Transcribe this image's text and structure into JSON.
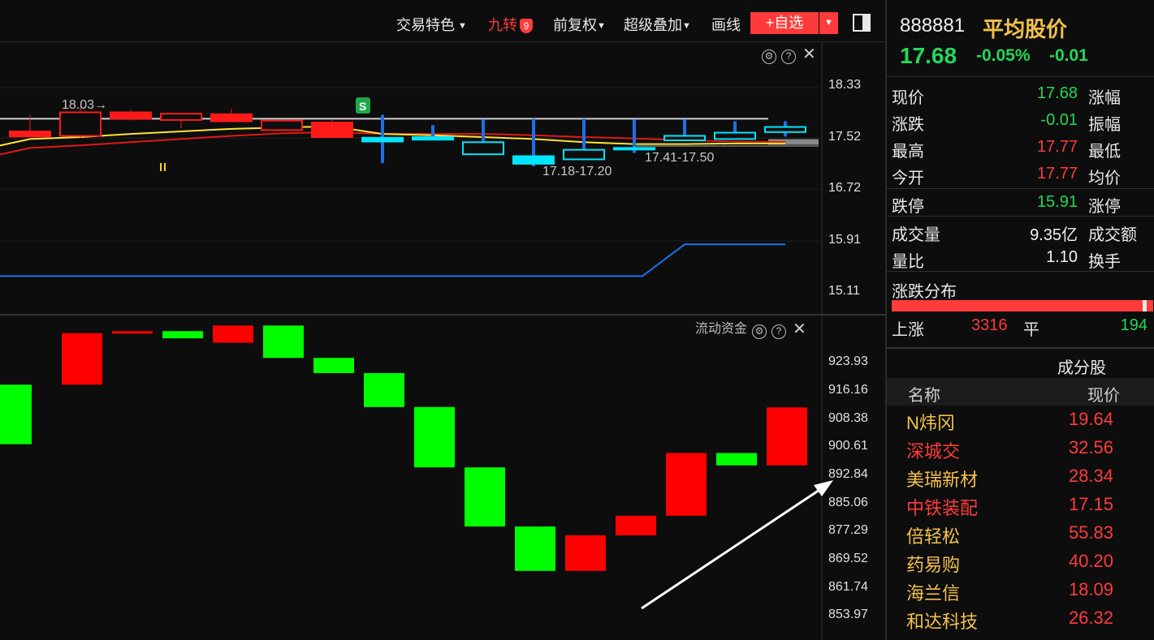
{
  "toolbar": {
    "trade_features": "交易特色",
    "jiuzhuan": "九转",
    "jiuzhuan_badge": "9",
    "fuquan": "前复权",
    "overlay": "超级叠加",
    "draw": "画线",
    "add_watch": "+自选"
  },
  "main_chart": {
    "axis_labels": [
      "18.33",
      "17.52",
      "16.72",
      "15.91",
      "15.11"
    ],
    "annotations": {
      "high_marker": "18.03→",
      "range_1": "17.18-17.20",
      "range_2": "17.41-17.50",
      "signal_badge": "S"
    }
  },
  "sub_chart": {
    "title": "流动资金",
    "axis_labels": [
      "923.93",
      "916.16",
      "908.38",
      "900.61",
      "892.84",
      "885.06",
      "877.29",
      "869.52",
      "861.74",
      "853.97"
    ]
  },
  "chart_data": [
    {
      "type": "candlestick",
      "note_colors": {
        "up": "#ff1a1a",
        "down": "#00e5ff",
        "ma_yellow": "#ffe234",
        "ma_red": "#e01818",
        "blue_line": "#1e6fe6"
      },
      "ylim": [
        15.11,
        18.33
      ],
      "candles": [
        {
          "open": 17.56,
          "close": 17.64,
          "high": 17.9,
          "low": 17.56,
          "dir": "up"
        },
        {
          "open": 17.57,
          "close": 17.94,
          "high": 18.03,
          "low": 17.54,
          "dir": "up"
        },
        {
          "open": 17.84,
          "close": 17.94,
          "high": 17.98,
          "low": 17.81,
          "dir": "up"
        },
        {
          "open": 17.82,
          "close": 17.92,
          "high": 17.92,
          "low": 17.69,
          "dir": "up"
        },
        {
          "open": 17.8,
          "close": 17.91,
          "high": 18.0,
          "low": 17.8,
          "dir": "up"
        },
        {
          "open": 17.66,
          "close": 17.81,
          "high": 17.81,
          "low": 17.66,
          "dir": "up"
        },
        {
          "open": 17.55,
          "close": 17.78,
          "high": 17.82,
          "low": 17.55,
          "dir": "up"
        },
        {
          "open": 17.54,
          "close": 17.48,
          "high": 17.9,
          "low": 17.14,
          "dir": "down"
        },
        {
          "open": 17.55,
          "close": 17.51,
          "high": 17.74,
          "low": 17.51,
          "dir": "down"
        },
        {
          "open": 17.47,
          "close": 17.28,
          "high": 17.83,
          "low": 17.28,
          "dir": "down"
        },
        {
          "open": 17.25,
          "close": 17.13,
          "high": 17.84,
          "low": 17.09,
          "dir": "down"
        },
        {
          "open": 17.35,
          "close": 17.2,
          "high": 17.84,
          "low": 17.2,
          "dir": "down"
        },
        {
          "open": 17.38,
          "close": 17.36,
          "high": 17.83,
          "low": 17.3,
          "dir": "down"
        },
        {
          "open": 17.57,
          "close": 17.5,
          "high": 17.83,
          "low": 17.5,
          "dir": "down"
        },
        {
          "open": 17.62,
          "close": 17.52,
          "high": 17.8,
          "low": 17.52,
          "dir": "down"
        },
        {
          "open": 17.71,
          "close": 17.63,
          "high": 17.8,
          "low": 17.56,
          "dir": "down"
        }
      ],
      "ma_yellow": [
        17.52,
        17.55,
        17.6,
        17.64,
        17.68,
        17.7,
        17.72,
        17.6,
        17.58,
        17.55,
        17.52,
        17.47,
        17.44,
        17.44,
        17.45,
        17.45
      ],
      "ma_red": [
        17.38,
        17.42,
        17.47,
        17.52,
        17.57,
        17.61,
        17.63,
        17.6,
        17.6,
        17.6,
        17.58,
        17.55,
        17.53,
        17.5,
        17.48,
        17.47
      ],
      "blue_line": [
        15.36,
        15.36,
        15.36,
        15.36,
        15.36,
        15.36,
        15.36,
        15.36,
        15.36,
        15.36,
        15.36,
        15.36,
        15.36,
        15.86,
        15.86,
        15.86
      ],
      "pressure_line": 17.41,
      "top_line": 17.84
    },
    {
      "type": "bar",
      "title": "流动资金",
      "ylim": [
        848,
        929
      ],
      "bars": [
        {
          "start": 911.9,
          "end": 897.0,
          "dir": "down"
        },
        {
          "start": 911.9,
          "end": 924.8,
          "dir": "up"
        },
        {
          "start": 924.8,
          "end": 925.3,
          "dir": "up"
        },
        {
          "start": 925.3,
          "end": 923.5,
          "dir": "down"
        },
        {
          "start": 922.4,
          "end": 926.7,
          "dir": "up"
        },
        {
          "start": 926.7,
          "end": 918.6,
          "dir": "down"
        },
        {
          "start": 918.6,
          "end": 914.8,
          "dir": "down"
        },
        {
          "start": 914.8,
          "end": 906.3,
          "dir": "down"
        },
        {
          "start": 906.3,
          "end": 891.2,
          "dir": "down"
        },
        {
          "start": 891.2,
          "end": 876.4,
          "dir": "down"
        },
        {
          "start": 876.4,
          "end": 865.3,
          "dir": "down"
        },
        {
          "start": 865.3,
          "end": 874.2,
          "dir": "up"
        },
        {
          "start": 874.2,
          "end": 879.1,
          "dir": "up"
        },
        {
          "start": 879.1,
          "end": 894.8,
          "dir": "up"
        },
        {
          "start": 894.8,
          "end": 891.7,
          "dir": "down"
        },
        {
          "start": 891.7,
          "end": 906.2,
          "dir": "up"
        }
      ]
    }
  ],
  "stock": {
    "code": "888881",
    "name": "平均股价",
    "price": "17.68",
    "pct": "-0.05%",
    "chg": "-0.01"
  },
  "quotes": [
    {
      "label": "现价",
      "value": "17.68",
      "color": "#22d85a",
      "label2": "涨幅"
    },
    {
      "label": "涨跌",
      "value": "-0.01",
      "color": "#22d85a",
      "label2": "振幅"
    },
    {
      "label": "最高",
      "value": "17.77",
      "color": "#ff3b3b",
      "label2": "最低"
    },
    {
      "label": "今开",
      "value": "17.77",
      "color": "#ff3b3b",
      "label2": "均价"
    },
    {
      "label": "跌停",
      "value": "15.91",
      "color": "#22d85a",
      "label2": "涨停"
    },
    {
      "label": "成交量",
      "value": "9.35亿",
      "color": "#f0f0f0",
      "label2": "成交额"
    },
    {
      "label": "量比",
      "value": "1.10",
      "color": "#f0f0f0",
      "label2": "换手"
    }
  ],
  "distribution": {
    "title": "涨跌分布",
    "up_label": "上涨",
    "up_count": "3316",
    "flat_label": "平",
    "flat_count": "194"
  },
  "components": {
    "title": "成分股",
    "col_name": "名称",
    "col_price": "现价",
    "rows": [
      {
        "name": "N炜冈",
        "price": "19.64",
        "color": "#f2c14a"
      },
      {
        "name": "深城交",
        "price": "32.56",
        "color": "#ff3b3b"
      },
      {
        "name": "美瑞新材",
        "price": "28.34",
        "color": "#f2c14a"
      },
      {
        "name": "中铁装配",
        "price": "17.15",
        "color": "#ff3b3b"
      },
      {
        "name": "倍轻松",
        "price": "55.83",
        "color": "#f2c14a"
      },
      {
        "name": "药易购",
        "price": "40.20",
        "color": "#f2c14a"
      },
      {
        "name": "海兰信",
        "price": "18.09",
        "color": "#f2c14a"
      },
      {
        "name": "和达科技",
        "price": "26.32",
        "color": "#f2c14a"
      }
    ]
  }
}
